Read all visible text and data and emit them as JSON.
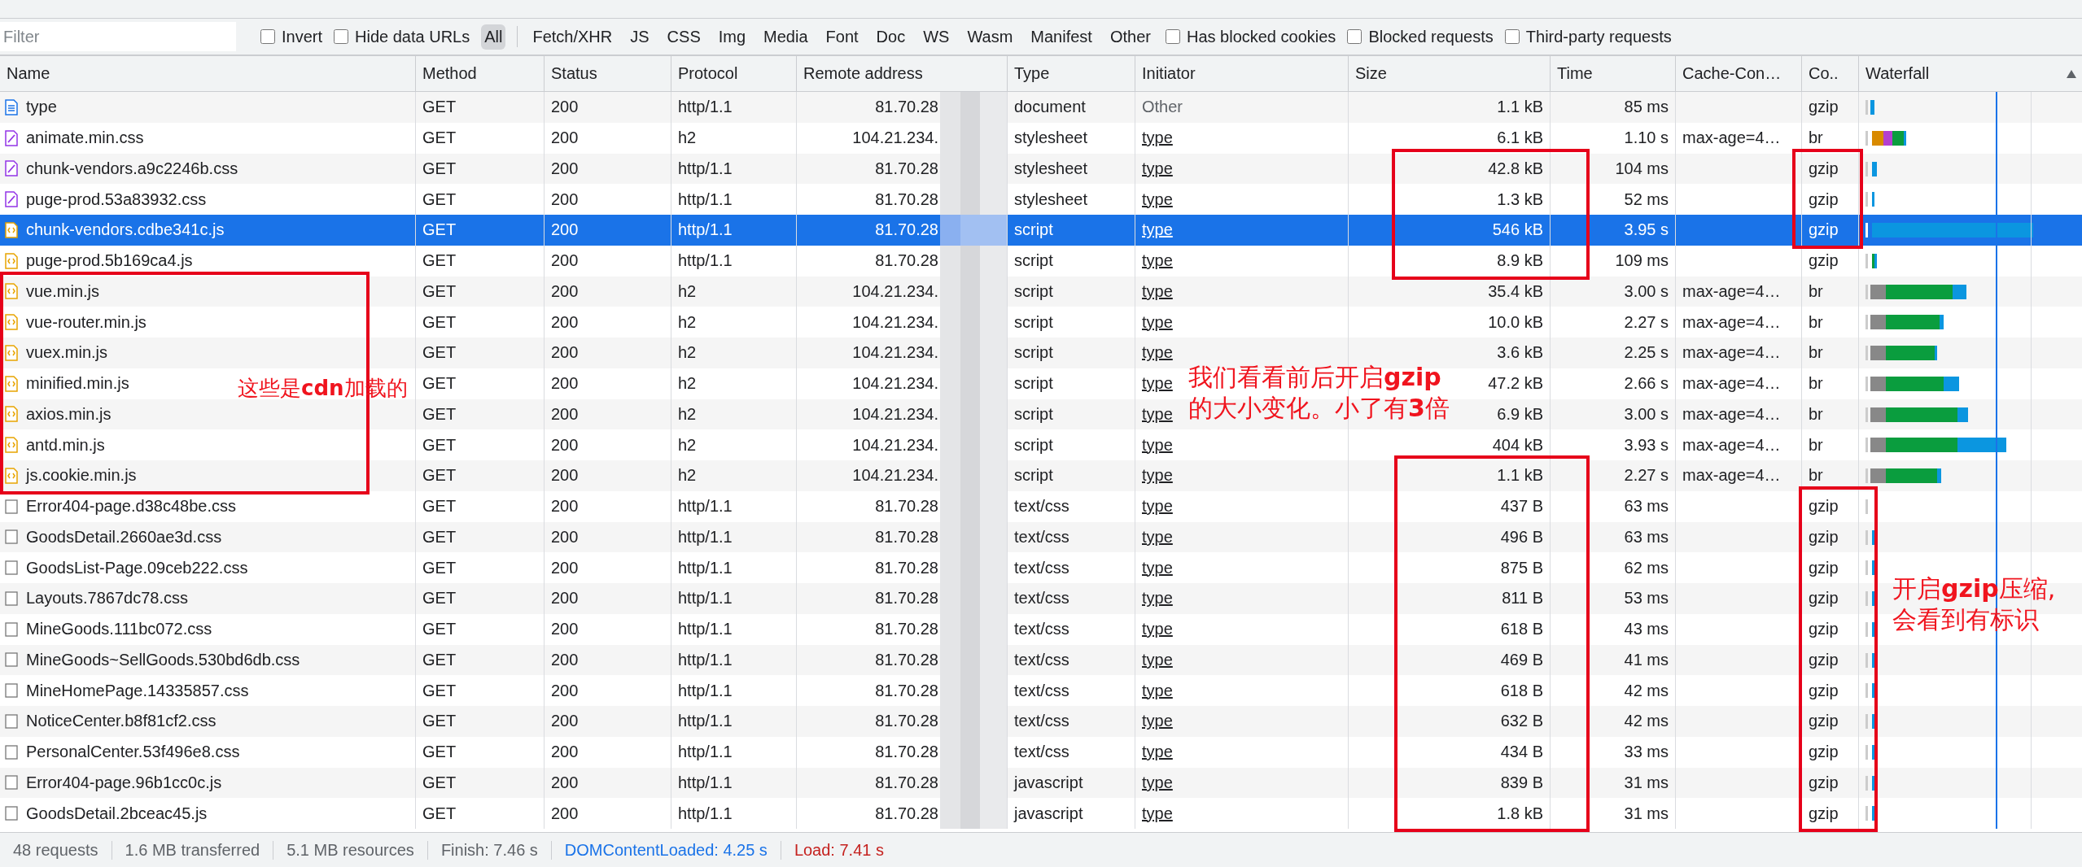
{
  "filter_bar": {
    "placeholder": "Filter",
    "checkboxes_left": [
      {
        "label": "Invert",
        "checked": false
      },
      {
        "label": "Hide data URLs",
        "checked": false
      }
    ],
    "type_filters": [
      {
        "label": "All",
        "selected": true
      },
      {
        "label": "Fetch/XHR",
        "selected": false
      },
      {
        "label": "JS",
        "selected": false
      },
      {
        "label": "CSS",
        "selected": false
      },
      {
        "label": "Img",
        "selected": false
      },
      {
        "label": "Media",
        "selected": false
      },
      {
        "label": "Font",
        "selected": false
      },
      {
        "label": "Doc",
        "selected": false
      },
      {
        "label": "WS",
        "selected": false
      },
      {
        "label": "Wasm",
        "selected": false
      },
      {
        "label": "Manifest",
        "selected": false
      },
      {
        "label": "Other",
        "selected": false
      }
    ],
    "checkboxes_right": [
      {
        "label": "Has blocked cookies",
        "checked": false
      },
      {
        "label": "Blocked requests",
        "checked": false
      },
      {
        "label": "Third-party requests",
        "checked": false
      }
    ]
  },
  "table": {
    "columns": [
      "Name",
      "Method",
      "Status",
      "Protocol",
      "Remote address",
      "Type",
      "Initiator",
      "Size",
      "Time",
      "Cache-Con…",
      "Co..",
      "Waterfall"
    ],
    "rows": [
      {
        "kind": "document",
        "name": "type",
        "method": "GET",
        "status": "200",
        "protocol": "http/1.1",
        "remote": "81.70.28",
        "type": "document",
        "initiator": "Other",
        "initiator_link": false,
        "size": "1.1 kB",
        "time": "85 ms",
        "cache": "",
        "encoding": "gzip",
        "selected": false
      },
      {
        "kind": "stylesheet",
        "name": "animate.min.css",
        "method": "GET",
        "status": "200",
        "protocol": "h2",
        "remote": "104.21.234.",
        "type": "stylesheet",
        "initiator": "type",
        "initiator_link": true,
        "size": "6.1 kB",
        "time": "1.10 s",
        "cache": "max-age=4…",
        "encoding": "br",
        "selected": false
      },
      {
        "kind": "stylesheet",
        "name": "chunk-vendors.a9c2246b.css",
        "method": "GET",
        "status": "200",
        "protocol": "http/1.1",
        "remote": "81.70.28",
        "type": "stylesheet",
        "initiator": "type",
        "initiator_link": true,
        "size": "42.8 kB",
        "time": "104 ms",
        "cache": "",
        "encoding": "gzip",
        "selected": false
      },
      {
        "kind": "stylesheet",
        "name": "puge-prod.53a83932.css",
        "method": "GET",
        "status": "200",
        "protocol": "http/1.1",
        "remote": "81.70.28",
        "type": "stylesheet",
        "initiator": "type",
        "initiator_link": true,
        "size": "1.3 kB",
        "time": "52 ms",
        "cache": "",
        "encoding": "gzip",
        "selected": false
      },
      {
        "kind": "script",
        "name": "chunk-vendors.cdbe341c.js",
        "method": "GET",
        "status": "200",
        "protocol": "http/1.1",
        "remote": "81.70.28",
        "type": "script",
        "initiator": "type",
        "initiator_link": true,
        "size": "546 kB",
        "time": "3.95 s",
        "cache": "",
        "encoding": "gzip",
        "selected": true
      },
      {
        "kind": "script",
        "name": "puge-prod.5b169ca4.js",
        "method": "GET",
        "status": "200",
        "protocol": "http/1.1",
        "remote": "81.70.28",
        "type": "script",
        "initiator": "type",
        "initiator_link": true,
        "size": "8.9 kB",
        "time": "109 ms",
        "cache": "",
        "encoding": "gzip",
        "selected": false
      },
      {
        "kind": "script",
        "name": "vue.min.js",
        "method": "GET",
        "status": "200",
        "protocol": "h2",
        "remote": "104.21.234.",
        "type": "script",
        "initiator": "type",
        "initiator_link": true,
        "size": "35.4 kB",
        "time": "3.00 s",
        "cache": "max-age=4…",
        "encoding": "br",
        "selected": false
      },
      {
        "kind": "script",
        "name": "vue-router.min.js",
        "method": "GET",
        "status": "200",
        "protocol": "h2",
        "remote": "104.21.234.",
        "type": "script",
        "initiator": "type",
        "initiator_link": true,
        "size": "10.0 kB",
        "time": "2.27 s",
        "cache": "max-age=4…",
        "encoding": "br",
        "selected": false
      },
      {
        "kind": "script",
        "name": "vuex.min.js",
        "method": "GET",
        "status": "200",
        "protocol": "h2",
        "remote": "104.21.234.",
        "type": "script",
        "initiator": "type",
        "initiator_link": true,
        "size": "3.6 kB",
        "time": "2.25 s",
        "cache": "max-age=4…",
        "encoding": "br",
        "selected": false
      },
      {
        "kind": "script",
        "name": "minified.min.js",
        "method": "GET",
        "status": "200",
        "protocol": "h2",
        "remote": "104.21.234.",
        "type": "script",
        "initiator": "type",
        "initiator_link": true,
        "size": "47.2 kB",
        "time": "2.66 s",
        "cache": "max-age=4…",
        "encoding": "br",
        "selected": false
      },
      {
        "kind": "script",
        "name": "axios.min.js",
        "method": "GET",
        "status": "200",
        "protocol": "h2",
        "remote": "104.21.234.",
        "type": "script",
        "initiator": "type",
        "initiator_link": true,
        "size": "6.9 kB",
        "time": "3.00 s",
        "cache": "max-age=4…",
        "encoding": "br",
        "selected": false
      },
      {
        "kind": "script",
        "name": "antd.min.js",
        "method": "GET",
        "status": "200",
        "protocol": "h2",
        "remote": "104.21.234.",
        "type": "script",
        "initiator": "type",
        "initiator_link": true,
        "size": "404 kB",
        "time": "3.93 s",
        "cache": "max-age=4…",
        "encoding": "br",
        "selected": false
      },
      {
        "kind": "script",
        "name": "js.cookie.min.js",
        "method": "GET",
        "status": "200",
        "protocol": "h2",
        "remote": "104.21.234.",
        "type": "script",
        "initiator": "type",
        "initiator_link": true,
        "size": "1.1 kB",
        "time": "2.27 s",
        "cache": "max-age=4…",
        "encoding": "br",
        "selected": false
      },
      {
        "kind": "plain",
        "name": "Error404-page.d38c48be.css",
        "method": "GET",
        "status": "200",
        "protocol": "http/1.1",
        "remote": "81.70.28",
        "type": "text/css",
        "initiator": "type",
        "initiator_link": true,
        "size": "437 B",
        "time": "63 ms",
        "cache": "",
        "encoding": "gzip",
        "selected": false
      },
      {
        "kind": "plain",
        "name": "GoodsDetail.2660ae3d.css",
        "method": "GET",
        "status": "200",
        "protocol": "http/1.1",
        "remote": "81.70.28",
        "type": "text/css",
        "initiator": "type",
        "initiator_link": true,
        "size": "496 B",
        "time": "63 ms",
        "cache": "",
        "encoding": "gzip",
        "selected": false
      },
      {
        "kind": "plain",
        "name": "GoodsList-Page.09ceb222.css",
        "method": "GET",
        "status": "200",
        "protocol": "http/1.1",
        "remote": "81.70.28",
        "type": "text/css",
        "initiator": "type",
        "initiator_link": true,
        "size": "875 B",
        "time": "62 ms",
        "cache": "",
        "encoding": "gzip",
        "selected": false
      },
      {
        "kind": "plain",
        "name": "Layouts.7867dc78.css",
        "method": "GET",
        "status": "200",
        "protocol": "http/1.1",
        "remote": "81.70.28",
        "type": "text/css",
        "initiator": "type",
        "initiator_link": true,
        "size": "811 B",
        "time": "53 ms",
        "cache": "",
        "encoding": "gzip",
        "selected": false
      },
      {
        "kind": "plain",
        "name": "MineGoods.111bc072.css",
        "method": "GET",
        "status": "200",
        "protocol": "http/1.1",
        "remote": "81.70.28",
        "type": "text/css",
        "initiator": "type",
        "initiator_link": true,
        "size": "618 B",
        "time": "43 ms",
        "cache": "",
        "encoding": "gzip",
        "selected": false
      },
      {
        "kind": "plain",
        "name": "MineGoods~SellGoods.530bd6db.css",
        "method": "GET",
        "status": "200",
        "protocol": "http/1.1",
        "remote": "81.70.28",
        "type": "text/css",
        "initiator": "type",
        "initiator_link": true,
        "size": "469 B",
        "time": "41 ms",
        "cache": "",
        "encoding": "gzip",
        "selected": false
      },
      {
        "kind": "plain",
        "name": "MineHomePage.14335857.css",
        "method": "GET",
        "status": "200",
        "protocol": "http/1.1",
        "remote": "81.70.28",
        "type": "text/css",
        "initiator": "type",
        "initiator_link": true,
        "size": "618 B",
        "time": "42 ms",
        "cache": "",
        "encoding": "gzip",
        "selected": false
      },
      {
        "kind": "plain",
        "name": "NoticeCenter.b8f81cf2.css",
        "method": "GET",
        "status": "200",
        "protocol": "http/1.1",
        "remote": "81.70.28",
        "type": "text/css",
        "initiator": "type",
        "initiator_link": true,
        "size": "632 B",
        "time": "42 ms",
        "cache": "",
        "encoding": "gzip",
        "selected": false
      },
      {
        "kind": "plain",
        "name": "PersonalCenter.53f496e8.css",
        "method": "GET",
        "status": "200",
        "protocol": "http/1.1",
        "remote": "81.70.28",
        "type": "text/css",
        "initiator": "type",
        "initiator_link": true,
        "size": "434 B",
        "time": "33 ms",
        "cache": "",
        "encoding": "gzip",
        "selected": false
      },
      {
        "kind": "plain",
        "name": "Error404-page.96b1cc0c.js",
        "method": "GET",
        "status": "200",
        "protocol": "http/1.1",
        "remote": "81.70.28",
        "type": "javascript",
        "initiator": "type",
        "initiator_link": true,
        "size": "839 B",
        "time": "31 ms",
        "cache": "",
        "encoding": "gzip",
        "selected": false
      },
      {
        "kind": "plain",
        "name": "GoodsDetail.2bceac45.js",
        "method": "GET",
        "status": "200",
        "protocol": "http/1.1",
        "remote": "81.70.28",
        "type": "javascript",
        "initiator": "type",
        "initiator_link": true,
        "size": "1.8 kB",
        "time": "31 ms",
        "cache": "",
        "encoding": "gzip",
        "selected": false
      }
    ]
  },
  "annotations": [
    "这些是**cdn**加载的",
    "我们看看前后开启**gzip**\n的大小变化。小了有**3**倍",
    "开启**gzip**压缩,\n会看到有标识"
  ],
  "status_bar": [
    {
      "kind": "plain",
      "text": "48 requests"
    },
    {
      "kind": "plain",
      "text": "1.6 MB transferred"
    },
    {
      "kind": "plain",
      "text": "5.1 MB resources"
    },
    {
      "kind": "plain",
      "text": "Finish: 7.46 s"
    },
    {
      "kind": "dom",
      "text": "DOMContentLoaded: 4.25 s"
    },
    {
      "kind": "load",
      "text": "Load: 7.41 s"
    }
  ]
}
